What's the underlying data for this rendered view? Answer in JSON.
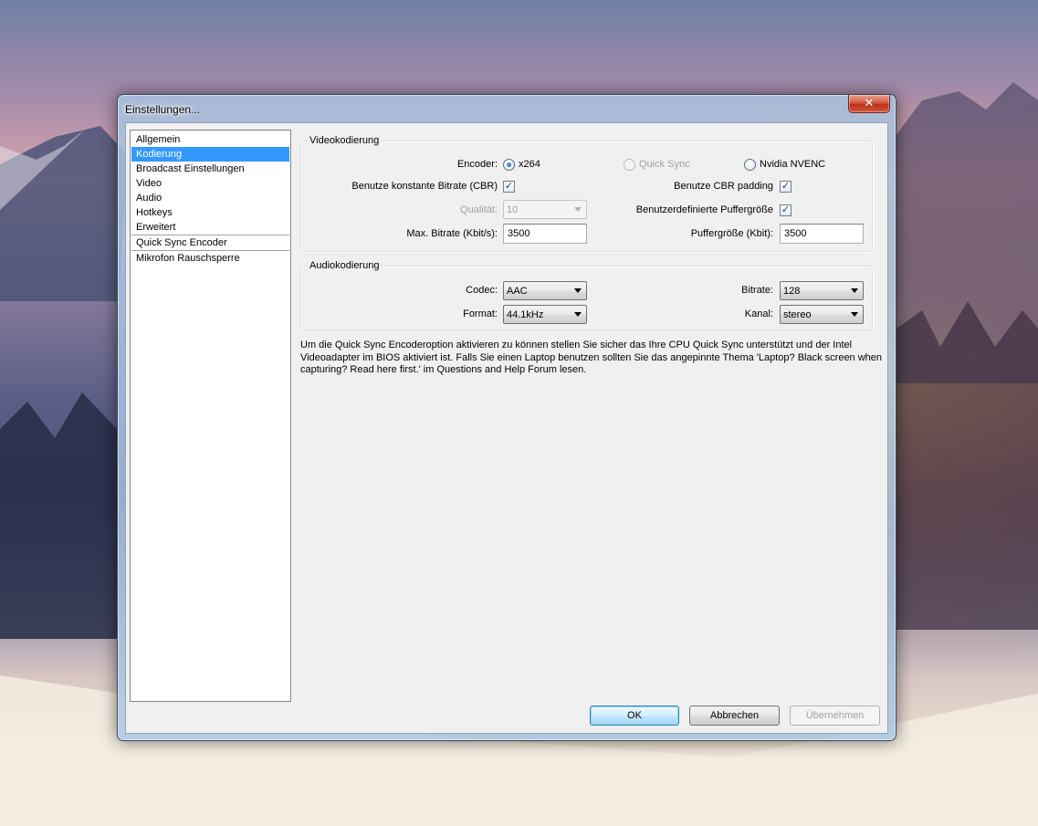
{
  "window": {
    "title": "Einstellungen...",
    "close_glyph": "✕"
  },
  "sidebar": {
    "items": [
      {
        "label": "Allgemein"
      },
      {
        "label": "Kodierung",
        "selected": true
      },
      {
        "label": "Broadcast Einstellungen"
      },
      {
        "label": "Video"
      },
      {
        "label": "Audio"
      },
      {
        "label": "Hotkeys"
      },
      {
        "label": "Erweitert"
      },
      {
        "label": "Quick Sync Encoder"
      },
      {
        "label": "Mikrofon Rauschsperre"
      }
    ]
  },
  "video": {
    "title": "Videokodierung",
    "encoder_label": "Encoder:",
    "encoder_options": [
      {
        "label": "x264",
        "checked": true,
        "enabled": true
      },
      {
        "label": "Quick Sync",
        "checked": false,
        "enabled": false
      },
      {
        "label": "Nvidia NVENC",
        "checked": false,
        "enabled": true
      }
    ],
    "cbr_label": "Benutze konstante Bitrate (CBR)",
    "cbr_checked": true,
    "cbr_padding_label": "Benutze CBR padding",
    "cbr_padding_checked": true,
    "quality_label": "Qualität:",
    "quality_value": "10",
    "custom_buffer_label": "Benutzerdefinierte Puffergröße",
    "custom_buffer_checked": true,
    "max_bitrate_label": "Max. Bitrate (Kbit/s):",
    "max_bitrate_value": "3500",
    "buffer_size_label": "Puffergröße (Kbit):",
    "buffer_size_value": "3500"
  },
  "audio": {
    "title": "Audiokodierung",
    "codec_label": "Codec:",
    "codec_value": "AAC",
    "bitrate_label": "Bitrate:",
    "bitrate_value": "128",
    "format_label": "Format:",
    "format_value": "44.1kHz",
    "channel_label": "Kanal:",
    "channel_value": "stereo"
  },
  "info_text": "Um die Quick Sync Encoderoption aktivieren zu können stellen Sie sicher das Ihre CPU Quick Sync unterstützt und der Intel Videoadapter im BIOS aktiviert ist. Falls Sie einen Laptop benutzen sollten Sie das angepinnte Thema 'Laptop? Black screen when capturing? Read here first.' im Questions and Help Forum lesen.",
  "buttons": {
    "ok": "OK",
    "cancel": "Abbrechen",
    "apply": "Übernehmen"
  },
  "check_glyph": "✓",
  "colors": {
    "selection": "#3399ff",
    "close": "#c7432a"
  }
}
